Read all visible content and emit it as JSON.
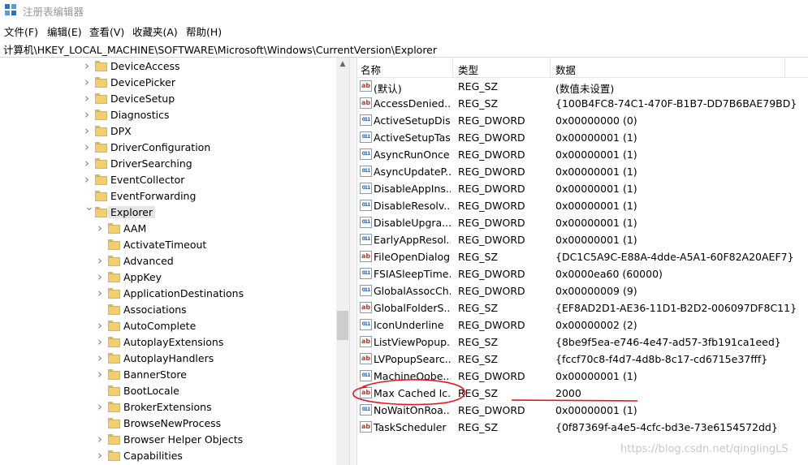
{
  "window": {
    "title": "注册表编辑器",
    "icon": "regedit-icon"
  },
  "menu": [
    "文件(F)",
    "编辑(E)",
    "查看(V)",
    "收藏夹(A)",
    "帮助(H)"
  ],
  "address": "计算机\\HKEY_LOCAL_MACHINE\\SOFTWARE\\Microsoft\\Windows\\CurrentVersion\\Explorer",
  "tree": {
    "items": [
      {
        "label": "DeviceAccess",
        "level": 0,
        "expander": "collapsed"
      },
      {
        "label": "DevicePicker",
        "level": 0,
        "expander": "collapsed"
      },
      {
        "label": "DeviceSetup",
        "level": 0,
        "expander": "collapsed"
      },
      {
        "label": "Diagnostics",
        "level": 0,
        "expander": "collapsed"
      },
      {
        "label": "DPX",
        "level": 0,
        "expander": "collapsed"
      },
      {
        "label": "DriverConfiguration",
        "level": 0,
        "expander": "collapsed"
      },
      {
        "label": "DriverSearching",
        "level": 0,
        "expander": "collapsed"
      },
      {
        "label": "EventCollector",
        "level": 0,
        "expander": "collapsed"
      },
      {
        "label": "EventForwarding",
        "level": 0,
        "expander": "none"
      },
      {
        "label": "Explorer",
        "level": 0,
        "expander": "expanded",
        "selected": true
      },
      {
        "label": "AAM",
        "level": 1,
        "expander": "collapsed"
      },
      {
        "label": "ActivateTimeout",
        "level": 1,
        "expander": "none"
      },
      {
        "label": "Advanced",
        "level": 1,
        "expander": "collapsed"
      },
      {
        "label": "AppKey",
        "level": 1,
        "expander": "collapsed"
      },
      {
        "label": "ApplicationDestinations",
        "level": 1,
        "expander": "collapsed"
      },
      {
        "label": "Associations",
        "level": 1,
        "expander": "none"
      },
      {
        "label": "AutoComplete",
        "level": 1,
        "expander": "collapsed"
      },
      {
        "label": "AutoplayExtensions",
        "level": 1,
        "expander": "collapsed"
      },
      {
        "label": "AutoplayHandlers",
        "level": 1,
        "expander": "collapsed"
      },
      {
        "label": "BannerStore",
        "level": 1,
        "expander": "collapsed"
      },
      {
        "label": "BootLocale",
        "level": 1,
        "expander": "none"
      },
      {
        "label": "BrokerExtensions",
        "level": 1,
        "expander": "collapsed"
      },
      {
        "label": "BrowseNewProcess",
        "level": 1,
        "expander": "none"
      },
      {
        "label": "Browser Helper Objects",
        "level": 1,
        "expander": "collapsed"
      },
      {
        "label": "Capabilities",
        "level": 1,
        "expander": "collapsed"
      }
    ]
  },
  "list": {
    "headers": {
      "name": "名称",
      "type": "类型",
      "data": "数据"
    },
    "rows": [
      {
        "name": "(默认)",
        "type": "REG_SZ",
        "data": "(数值未设置)",
        "kind": "sz"
      },
      {
        "name": "AccessDenied...",
        "type": "REG_SZ",
        "data": "{100B4FC8-74C1-470F-B1B7-DD7B6BAE79BD}",
        "kind": "sz"
      },
      {
        "name": "ActiveSetupDis...",
        "type": "REG_DWORD",
        "data": "0x00000000 (0)",
        "kind": "dword"
      },
      {
        "name": "ActiveSetupTas...",
        "type": "REG_DWORD",
        "data": "0x00000001 (1)",
        "kind": "dword"
      },
      {
        "name": "AsyncRunOnce",
        "type": "REG_DWORD",
        "data": "0x00000001 (1)",
        "kind": "dword"
      },
      {
        "name": "AsyncUpdateP...",
        "type": "REG_DWORD",
        "data": "0x00000001 (1)",
        "kind": "dword"
      },
      {
        "name": "DisableAppIns...",
        "type": "REG_DWORD",
        "data": "0x00000001 (1)",
        "kind": "dword"
      },
      {
        "name": "DisableResolv...",
        "type": "REG_DWORD",
        "data": "0x00000001 (1)",
        "kind": "dword"
      },
      {
        "name": "DisableUpgra...",
        "type": "REG_DWORD",
        "data": "0x00000001 (1)",
        "kind": "dword"
      },
      {
        "name": "EarlyAppResol...",
        "type": "REG_DWORD",
        "data": "0x00000001 (1)",
        "kind": "dword"
      },
      {
        "name": "FileOpenDialog",
        "type": "REG_SZ",
        "data": "{DC1C5A9C-E88A-4dde-A5A1-60F82A20AEF7}",
        "kind": "sz"
      },
      {
        "name": "FSIASleepTime...",
        "type": "REG_DWORD",
        "data": "0x0000ea60 (60000)",
        "kind": "dword"
      },
      {
        "name": "GlobalAssocCh...",
        "type": "REG_DWORD",
        "data": "0x00000009 (9)",
        "kind": "dword"
      },
      {
        "name": "GlobalFolderS...",
        "type": "REG_SZ",
        "data": "{EF8AD2D1-AE36-11D1-B2D2-006097DF8C11}",
        "kind": "sz"
      },
      {
        "name": "IconUnderline",
        "type": "REG_DWORD",
        "data": "0x00000002 (2)",
        "kind": "dword"
      },
      {
        "name": "ListViewPopup...",
        "type": "REG_SZ",
        "data": "{8be9f5ea-e746-4e47-ad57-3fb191ca1eed}",
        "kind": "sz"
      },
      {
        "name": "LVPopupSearc...",
        "type": "REG_SZ",
        "data": "{fccf70c8-f4d7-4d8b-8c17-cd6715e37fff}",
        "kind": "sz"
      },
      {
        "name": "MachineOobe...",
        "type": "REG_DWORD",
        "data": "0x00000001 (1)",
        "kind": "dword"
      },
      {
        "name": "Max Cached Ic...",
        "type": "REG_SZ",
        "data": "2000",
        "kind": "sz"
      },
      {
        "name": "NoWaitOnRoa...",
        "type": "REG_DWORD",
        "data": "0x00000001 (1)",
        "kind": "dword"
      },
      {
        "name": "TaskScheduler",
        "type": "REG_SZ",
        "data": "{0f87369f-a4e5-4cfc-bd3e-73e6154572dd}",
        "kind": "sz"
      }
    ]
  },
  "watermark": "https://blog.csdn.net/qinglingLS",
  "colors": {
    "annotation": "#e8141b",
    "folder": "#f3cf6b",
    "selected": "#e5e5e5"
  }
}
